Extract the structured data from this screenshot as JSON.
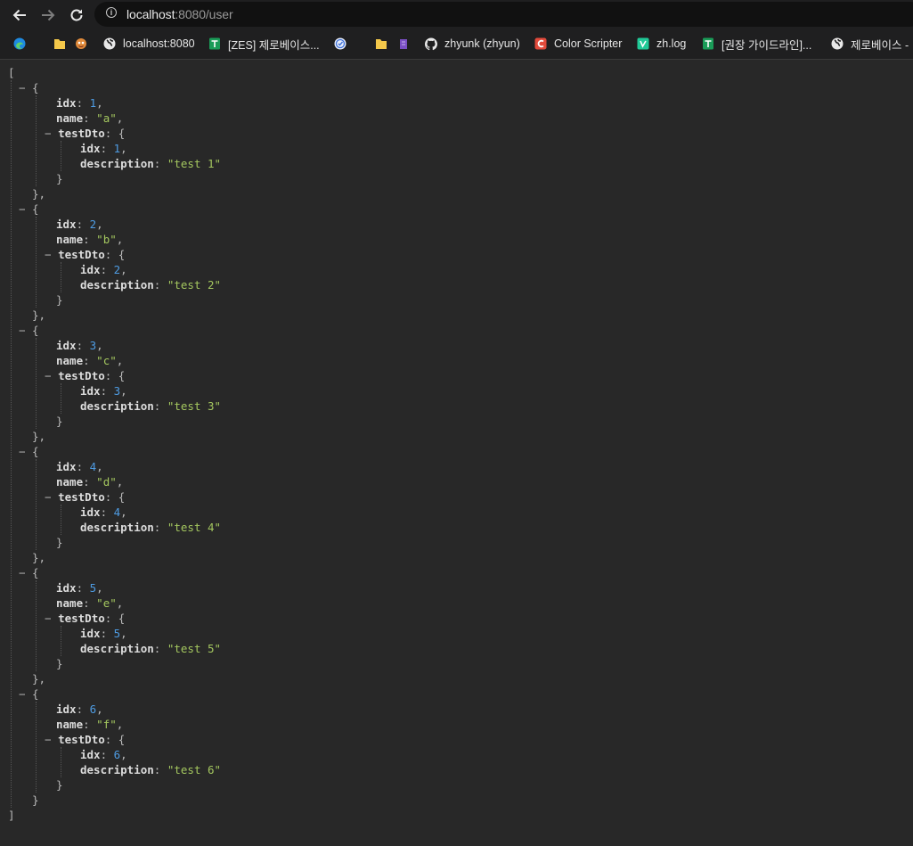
{
  "browser": {
    "url_host": "localhost",
    "url_rest": ":8080/user",
    "bookmarks": [
      {
        "label": "",
        "icon": "edge-icon"
      },
      {
        "label": "",
        "icon": "folder-icon"
      },
      {
        "label": "",
        "icon": "mascot-icon"
      },
      {
        "label": "localhost:8080",
        "icon": "globe-icon"
      },
      {
        "label": "[ZES] 제로베이스...",
        "icon": "sheets-icon"
      },
      {
        "label": "",
        "icon": "check-badge-icon"
      },
      {
        "label": "",
        "icon": "folder-icon"
      },
      {
        "label": "",
        "icon": "purple-app-icon"
      },
      {
        "label": "zhyunk (zhyun)",
        "icon": "github-icon"
      },
      {
        "label": "Color Scripter",
        "icon": "color-scripter-icon"
      },
      {
        "label": "zh.log",
        "icon": "velog-icon"
      },
      {
        "label": "[권장 가이드라인]...",
        "icon": "sheets-icon"
      },
      {
        "label": "제로베이스 -",
        "icon": "globe-icon"
      }
    ]
  },
  "json": {
    "open_bracket": "[",
    "close_bracket": "]",
    "toggle": "−",
    "users": [
      {
        "idx": "1",
        "name": "\"a\"",
        "dto_idx": "1",
        "description": "\"test 1\""
      },
      {
        "idx": "2",
        "name": "\"b\"",
        "dto_idx": "2",
        "description": "\"test 2\""
      },
      {
        "idx": "3",
        "name": "\"c\"",
        "dto_idx": "3",
        "description": "\"test 3\""
      },
      {
        "idx": "4",
        "name": "\"d\"",
        "dto_idx": "4",
        "description": "\"test 4\""
      },
      {
        "idx": "5",
        "name": "\"e\"",
        "dto_idx": "5",
        "description": "\"test 5\""
      },
      {
        "idx": "6",
        "name": "\"f\"",
        "dto_idx": "6",
        "description": "\"test 6\""
      }
    ],
    "keys": {
      "idx": "idx",
      "name": "name",
      "test_dto": "testDto",
      "description": "description"
    }
  }
}
